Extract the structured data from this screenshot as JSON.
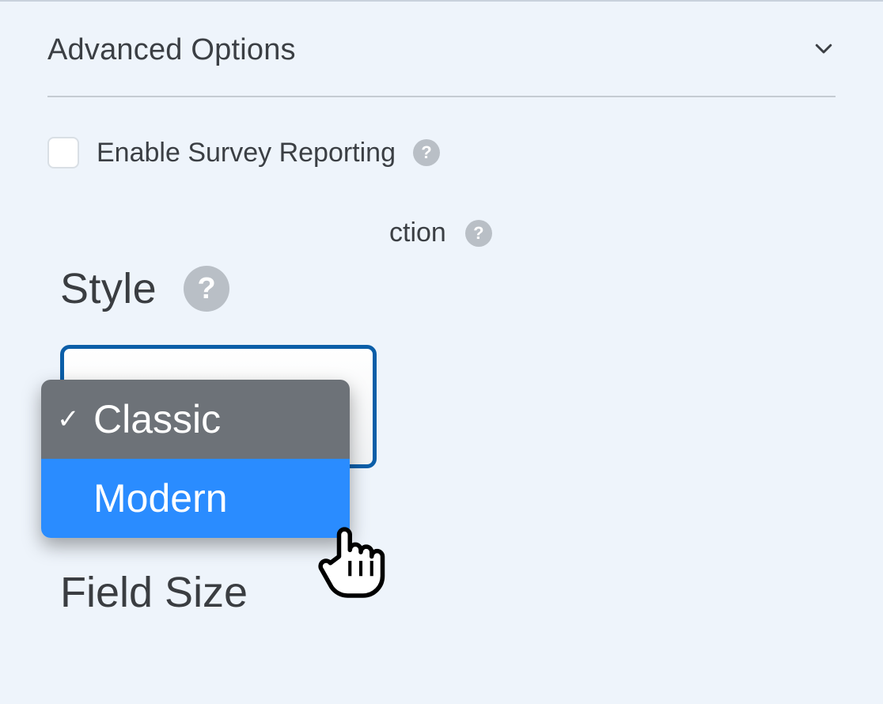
{
  "section": {
    "title": "Advanced Options"
  },
  "options": {
    "survey": {
      "label": "Enable Survey Reporting"
    },
    "partial": {
      "label_fragment": "ction"
    }
  },
  "magnifier": {
    "style_label": "Style",
    "field_size_label": "Field Size",
    "dropdown": {
      "option_selected": "Classic",
      "option_hovered": "Modern"
    }
  }
}
